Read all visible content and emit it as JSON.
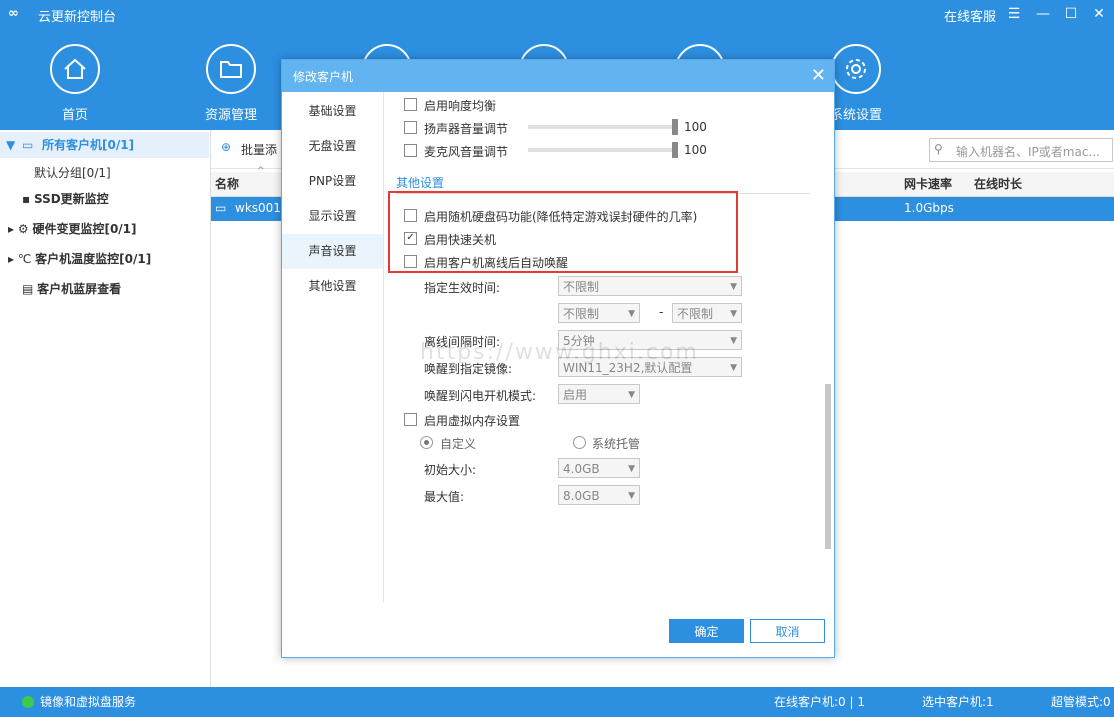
{
  "app": {
    "title": "云更新控制台",
    "logo": "∞"
  },
  "titlebar": {
    "support": "在线客服"
  },
  "nav": [
    {
      "label": "首页",
      "icon": "home-icon"
    },
    {
      "label": "资源管理",
      "icon": "folder-icon"
    },
    {
      "label": "系统设置",
      "icon": "gear-icon"
    }
  ],
  "tree": {
    "all_clients": "所有客户机[0/1]",
    "default_group": "默认分组[0/1]",
    "ssd": "SSD更新监控",
    "hardware": "硬件变更监控[0/1]",
    "temperature": "客户机温度监控[0/1]",
    "bluescreen": "客户机蓝屏查看"
  },
  "main": {
    "batch_add": "批量添",
    "search_placeholder": "输入机器名、IP或者mac...",
    "columns": {
      "name": "名称",
      "nic_speed": "网卡速率",
      "online_time": "在线时长"
    },
    "row": {
      "name": "wks001",
      "nic_speed": "1.0Gbps"
    }
  },
  "statusbar": {
    "service": "镜像和虚拟盘服务",
    "online": "在线客户机:0 | 1",
    "selected": "选中客户机:1",
    "super_mode": "超管模式:0"
  },
  "dialog": {
    "title": "修改客户机",
    "tabs": [
      "基础设置",
      "无盘设置",
      "PNP设置",
      "显示设置",
      "声音设置",
      "其他设置"
    ],
    "active_tab": "声音设置",
    "sound": {
      "loudness": "启用响度均衡",
      "speaker": "扬声器音量调节",
      "speaker_value": "100",
      "mic": "麦克风音量调节",
      "mic_value": "100"
    },
    "other": {
      "section": "其他设置",
      "random_disk": "启用随机硬盘码功能(降低特定游戏误封硬件的几率)",
      "fast_shutdown": "启用快速关机",
      "auto_wake": "启用客户机离线后自动唤醒",
      "effective_time_label": "指定生效时间:",
      "effective_time_value": "不限制",
      "range_start": "不限制",
      "range_sep": "-",
      "range_end": "不限制",
      "offline_interval_label": "离线间隔时间:",
      "offline_interval_value": "5分钟",
      "wake_image_label": "唤醒到指定镜像:",
      "wake_image_value": "WIN11_23H2,默认配置",
      "wake_mode_label": "唤醒到闪电开机模式:",
      "wake_mode_value": "启用",
      "vm_label": "启用虚拟内存设置",
      "custom": "自定义",
      "system_managed": "系统托管",
      "initial_label": "初始大小:",
      "initial_value": "4.0GB",
      "max_label": "最大值:",
      "max_value": "8.0GB"
    },
    "ok": "确定",
    "cancel": "取消"
  },
  "watermark": "https://www.ghxi.com",
  "colors": {
    "accent": "#2d8fe0",
    "highlight": "#e53935",
    "dialog_title": "#62b4f0"
  }
}
